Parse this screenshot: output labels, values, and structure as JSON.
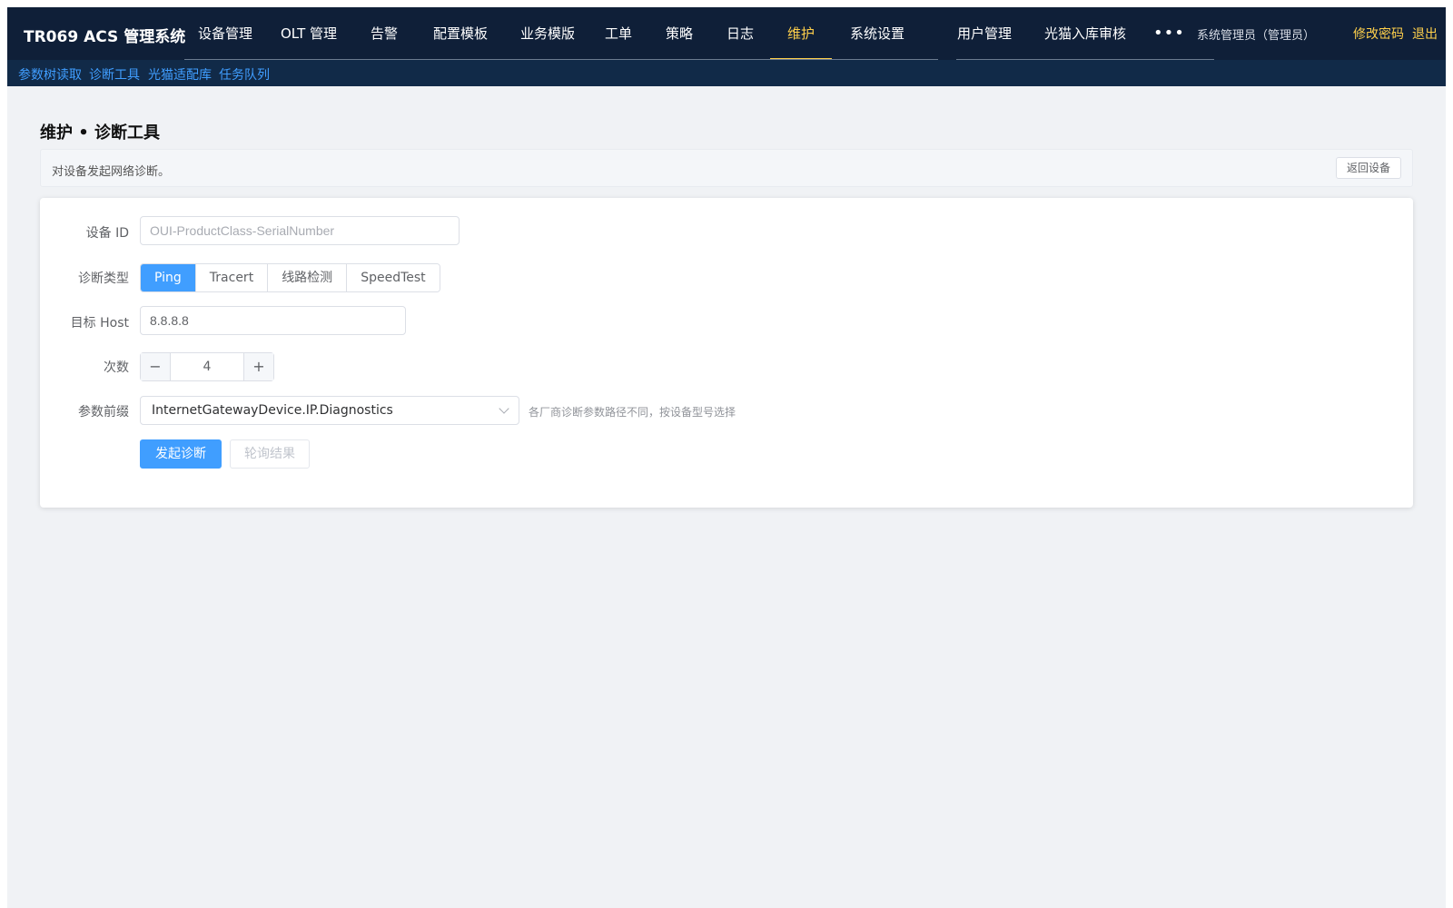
{
  "app": {
    "title": "TR069 ACS 管理系统"
  },
  "topnav": {
    "items": [
      {
        "label": "设备管理"
      },
      {
        "label": "OLT 管理"
      },
      {
        "label": "告警"
      },
      {
        "label": "配置模板"
      },
      {
        "label": "业务模版"
      },
      {
        "label": "工单"
      },
      {
        "label": "策略"
      },
      {
        "label": "日志"
      },
      {
        "label": "维护",
        "active": true
      },
      {
        "label": "系统设置"
      },
      {
        "label": "用户管理"
      },
      {
        "label": "光猫入库审核"
      }
    ],
    "more_icon": "ellipsis-icon",
    "active_color": "#ffd04b",
    "background": "#0f1f38"
  },
  "user": {
    "name": "系统管理员（管理员）",
    "change_password": "修改密码",
    "logout": "退出"
  },
  "subnav": {
    "items": [
      "参数树读取",
      "诊断工具",
      "光猫适配库",
      "任务队列"
    ]
  },
  "page": {
    "title": "维护 • 诊断工具",
    "description": "对设备发起网络诊断。",
    "back_button": "返回设备"
  },
  "form": {
    "device_id": {
      "label": "设备 ID",
      "value": "",
      "placeholder": "OUI-ProductClass-SerialNumber"
    },
    "diag_type": {
      "label": "诊断类型",
      "options": [
        "Ping",
        "Tracert",
        "线路检测",
        "SpeedTest"
      ],
      "selected": "Ping"
    },
    "target_host": {
      "label": "目标 Host",
      "value": "8.8.8.8"
    },
    "count": {
      "label": "次数",
      "value": "4"
    },
    "param_prefix": {
      "label": "参数前缀",
      "value": "InternetGatewayDevice.IP.Diagnostics",
      "hint": "各厂商诊断参数路径不同，按设备型号选择"
    },
    "buttons": {
      "start": "发起诊断",
      "poll": "轮询结果"
    }
  },
  "colors": {
    "primary": "#409eff",
    "page_bg": "#f0f2f5"
  }
}
